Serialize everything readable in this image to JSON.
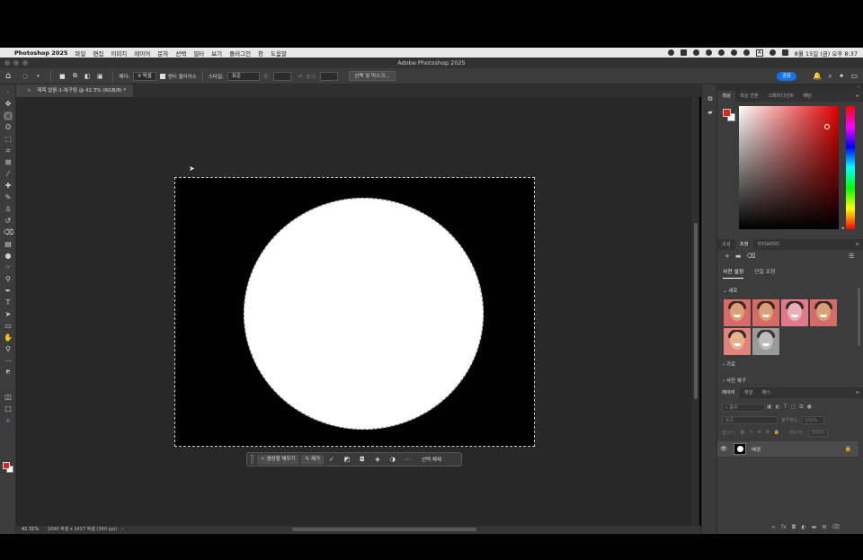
{
  "menubar": {
    "app_name": "Photoshop 2025",
    "items": [
      "파일",
      "편집",
      "이미지",
      "레이어",
      "문자",
      "선택",
      "필터",
      "보기",
      "플러그인",
      "창",
      "도움말"
    ],
    "clock": "8월 15일 (금) 오후 8:37",
    "input_source": "A"
  },
  "window": {
    "title": "Adobe Photoshop 2025"
  },
  "options": {
    "feather_label": "페더:",
    "feather_value": "0 픽셀",
    "antialias_label": "앤티 앨리어스",
    "style_label": "스타일:",
    "style_value": "표준",
    "width_label": "폭:",
    "height_label": "높이:",
    "select_mask_label": "선택 및 마스크...",
    "share_label": "공유"
  },
  "document": {
    "tab_title": "제목 없음-1-복구됨 @ 42.3% (RGB/8) *",
    "zoom": "42.31%",
    "info": "1690 픽셀 x 1417 픽셀 (300 ppi)"
  },
  "contextual_bar": {
    "generative_fill": "생성형 채우기",
    "remove": "제거",
    "deselect": "선택 해제"
  },
  "color_panel": {
    "tabs": [
      "색상",
      "색상 견본",
      "그레이디언트",
      "패턴"
    ],
    "foreground": "#e1251b",
    "background": "#ffffff"
  },
  "adjustments_panel": {
    "tabs": [
      "속성",
      "조정",
      "라이브러리"
    ],
    "subtabs": [
      "사전 설정",
      "단일 조정"
    ],
    "portrait_section": "세로",
    "landscape_section": "가로",
    "photo_repair_section": "사진 복구"
  },
  "layers_panel": {
    "tabs": [
      "레이어",
      "채널",
      "패스"
    ],
    "search_placeholder": "종류",
    "blend_mode": "표준",
    "opacity_label": "불투명도:",
    "opacity_value": "100%",
    "lock_label": "잠그기:",
    "fill_label": "채우기:",
    "fill_value": "100%",
    "layer_name": "배경"
  }
}
